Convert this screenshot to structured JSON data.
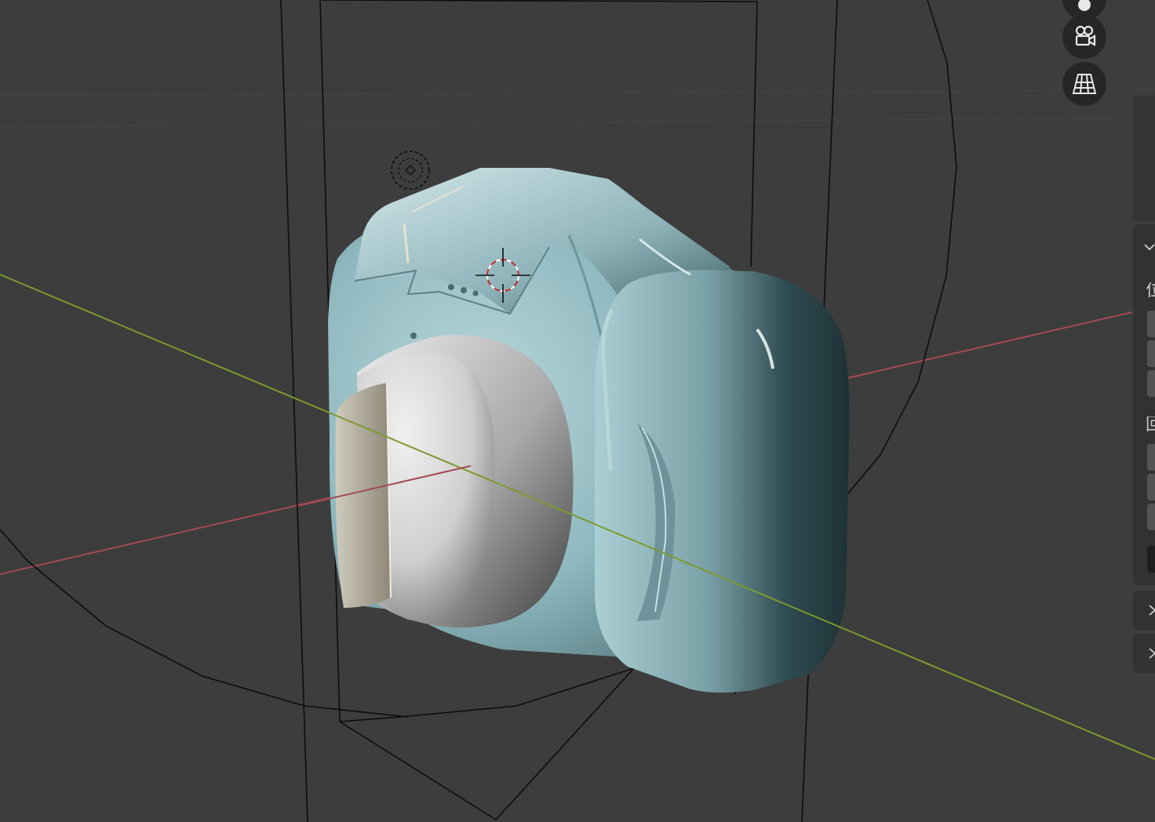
{
  "viewport": {
    "background": "#3d3d3d",
    "axis_x_color": "#a34a55",
    "axis_y_color": "#7c9a2e",
    "camera_body_color": "#9fc4ca",
    "lens_color": "#d7d7d7"
  },
  "nav_gizmo": {
    "buttons": [
      {
        "icon": "view-icon"
      },
      {
        "icon": "camera-view-icon"
      },
      {
        "icon": "perspective-grid-icon"
      }
    ]
  },
  "properties_panel": {
    "location_glyph": "位",
    "rotation_glyph": "回",
    "collapsed_sections": [
      "›",
      "›"
    ]
  }
}
